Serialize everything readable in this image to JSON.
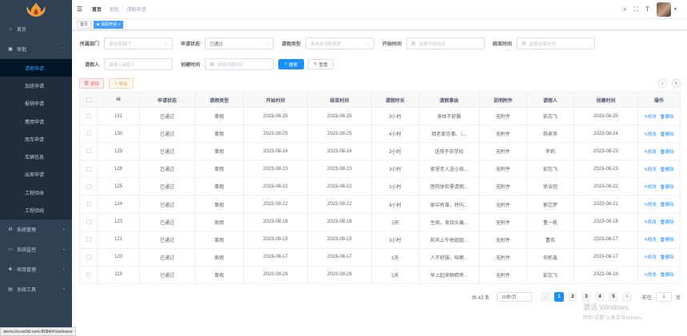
{
  "sidebar": {
    "items": [
      {
        "label": "首页",
        "icon": "home-icon"
      },
      {
        "label": "审批",
        "icon": "approval-icon",
        "open": true
      },
      {
        "label": "系统管理",
        "icon": "gear-icon"
      },
      {
        "label": "系统监控",
        "icon": "monitor-icon"
      },
      {
        "label": "项目管理",
        "icon": "project-icon"
      },
      {
        "label": "系统工具",
        "icon": "tool-icon"
      }
    ],
    "sub_items": [
      "请假申请",
      "加班申请",
      "报销申请",
      "费用申请",
      "用车申请",
      "车辆信息",
      "出差申请",
      "工程验收",
      "工程验线"
    ]
  },
  "status_url": "demo.bcsw3d.com:8084/#/oa/leave",
  "navbar": {
    "breadcrumb": [
      "首页",
      "审批",
      "请假申请"
    ]
  },
  "tags": {
    "home": "首页",
    "active": "请假申请"
  },
  "search": {
    "dept_label": "所属部门",
    "dept_placeholder": "请选择部门",
    "status_label": "申请状态",
    "status_value": "已通过",
    "type_label": "请假类型",
    "type_placeholder": "请选择请假类型",
    "start_label": "开始时间",
    "start_placeholder": "选择开始时间",
    "end_label": "结束时间",
    "end_placeholder": "选择结束时间",
    "applicant_label": "请假人",
    "applicant_placeholder": "请输入请假人",
    "created_label": "创建时间",
    "created_placeholder": "选择创建时间",
    "search_btn": "搜索",
    "reset_btn": "重置"
  },
  "toolbar": {
    "delete_btn": "删除",
    "export_btn": "导出"
  },
  "table": {
    "columns": [
      "id",
      "申请状态",
      "请假类型",
      "开始时间",
      "结束时间",
      "请假时长",
      "请假事由",
      "说明附件",
      "请假人",
      "创建时间",
      "操作"
    ],
    "edit_label": "修改",
    "delete_label": "删除",
    "rows": [
      [
        "131",
        "已通过",
        "事假",
        "2023-08-25",
        "2023-08-25",
        "3小时",
        "身体不舒服",
        "无附件",
        "彭志飞",
        "2023-08-25"
      ],
      [
        "130",
        "已通过",
        "事假",
        "2023-08-25",
        "2023-08-25",
        "4小时",
        "回老家办事。（...",
        "无附件",
        "杨蒸萍",
        "2023-08-24"
      ],
      [
        "129",
        "已通过",
        "事假",
        "2023-08-24",
        "2023-08-24",
        "3小时",
        "送孩子去学校",
        "无附件",
        "李莉",
        "2023-08-23"
      ],
      [
        "128",
        "已通过",
        "事假",
        "2023-08-23",
        "2023-08-23",
        "3小时",
        "家里老人送小孩...",
        "无附件",
        "彭志飞",
        "2023-08-23"
      ],
      [
        "125",
        "已通过",
        "事假",
        "2023-08-22",
        "2023-08-22",
        "1小时",
        "医院体检需请假...",
        "无附件",
        "徐治钽",
        "2023-08-22"
      ],
      [
        "124",
        "已通过",
        "事假",
        "2023-08-22",
        "2023-08-22",
        "4小时",
        "家中有事，特向...",
        "无附件",
        "郭芯梦",
        "2023-08-21"
      ],
      [
        "123",
        "已通过",
        "病假",
        "2023-08-18",
        "2023-08-18",
        "1天",
        "生病，发烧头痛...",
        "无附件",
        "董一帆",
        "2023-08-18"
      ],
      [
        "121",
        "已通过",
        "事假",
        "2023-08-15",
        "2023-08-15",
        "3小时",
        "前天上午他姐姐...",
        "无附件",
        "曹伟",
        "2023-08-17"
      ],
      [
        "120",
        "已通过",
        "病假",
        "2023-08-17",
        "2023-08-17",
        "1天",
        "人不舒服，咳嗽...",
        "无附件",
        "何栋鑫",
        "2023-08-17"
      ],
      [
        "119",
        "已通过",
        "事假",
        "2023-08-16",
        "2023-08-16",
        "1天",
        "早上起来眼睛疼...",
        "无附件",
        "彭志飞",
        "2023-08-16"
      ]
    ]
  },
  "pagination": {
    "total_text": "共 43 条",
    "page_size": "10条/页",
    "pages": [
      "1",
      "2",
      "3",
      "4",
      "5"
    ],
    "current": "1",
    "goto_label": "前往",
    "goto_value": "1",
    "goto_suffix": "页"
  },
  "watermark": {
    "line1": "激活 Windows",
    "line2": "转到\"设置\"以激活 Windows。"
  },
  "colors": {
    "sidebar_bg": "#304156",
    "primary": "#1890ff",
    "active_menu": "#409eff"
  }
}
